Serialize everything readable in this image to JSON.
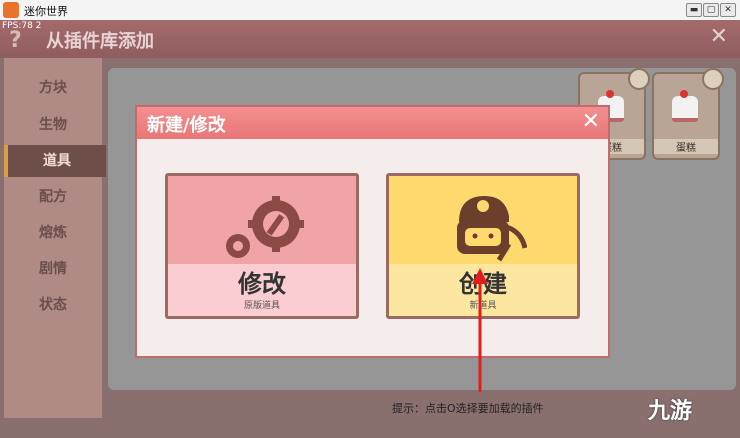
{
  "window": {
    "title": "迷你世界",
    "minimize": "▬",
    "maximize": "▢",
    "close": "✕"
  },
  "game": {
    "fps": "FPS:78 2",
    "help": "?",
    "header_title": "从插件库添加",
    "header_close": "✕",
    "sidebar": [
      {
        "label": "方块"
      },
      {
        "label": "生物"
      },
      {
        "label": "道具",
        "active": true
      },
      {
        "label": "配方"
      },
      {
        "label": "熔炼"
      },
      {
        "label": "剧情"
      },
      {
        "label": "状态"
      }
    ],
    "cards": [
      {
        "label": "蛋糕"
      },
      {
        "label": "蛋糕"
      }
    ],
    "hint": "提示：点击O选择要加载的插件"
  },
  "dialog": {
    "title": "新建/修改",
    "close": "✕",
    "modify": {
      "label": "修改",
      "sub": "原版道具"
    },
    "create": {
      "label": "创建",
      "sub": "新道具"
    }
  },
  "watermark": "九游",
  "colors": {
    "accent_red": "#e87777",
    "create_yellow": "#fdd96e",
    "modify_pink": "#f1a4a7",
    "arrow": "#e11d1d"
  }
}
